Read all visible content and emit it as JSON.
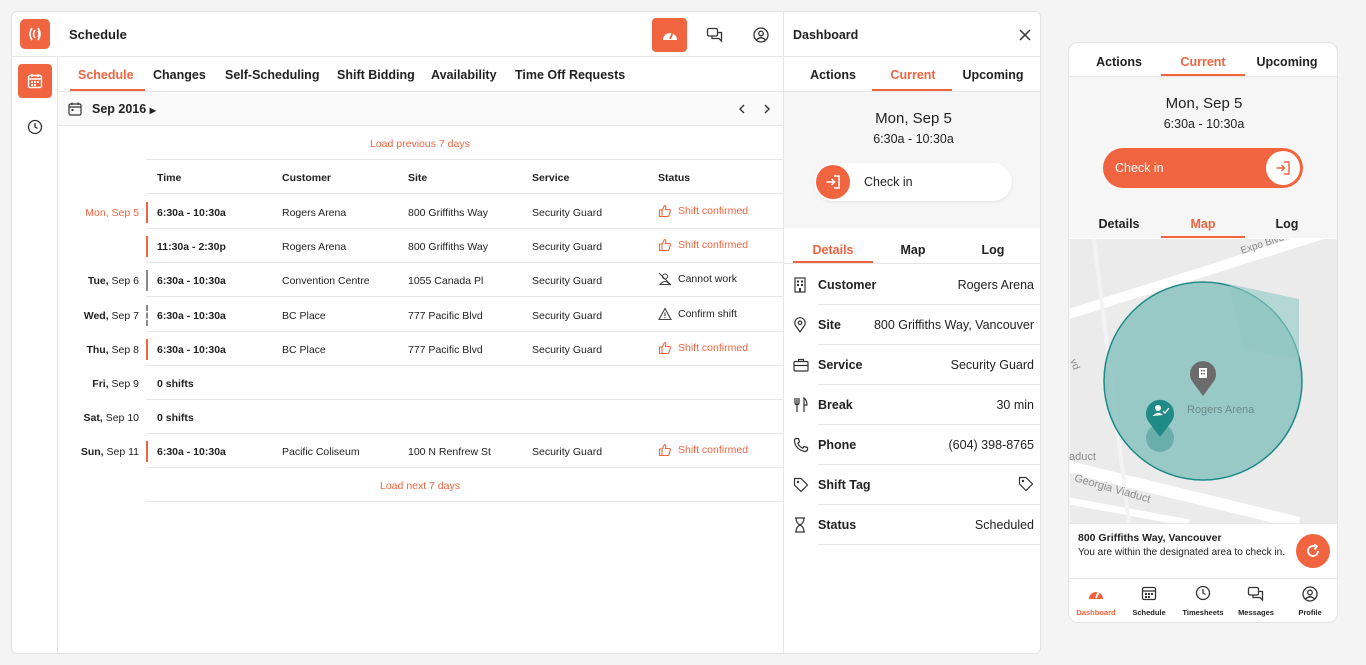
{
  "app": {
    "title": "Schedule"
  },
  "tabs": [
    "Schedule",
    "Changes",
    "Self-Scheduling",
    "Shift Bidding",
    "Availability",
    "Time Off Requests"
  ],
  "month": {
    "label": "Sep 2016"
  },
  "load_previous": "Load previous 7 days",
  "load_next": "Load next 7 days",
  "table": {
    "headers": [
      "Time",
      "Customer",
      "Site",
      "Service",
      "Status"
    ],
    "rows": [
      {
        "day_name": "Mon,",
        "day_num": "Sep 5",
        "time": "6:30a - 10:30a",
        "customer": "Rogers Arena",
        "site": "800 Griffiths Way",
        "service": "Security Guard",
        "status": "Shift confirmed"
      },
      {
        "day_name": "",
        "day_num": "",
        "time": "11:30a - 2:30p",
        "customer": "Rogers Arena",
        "site": "800 Griffiths Way",
        "service": "Security Guard",
        "status": "Shift confirmed"
      },
      {
        "day_name": "Tue,",
        "day_num": "Sep 6",
        "time": "6:30a - 10:30a",
        "customer": "Convention Centre",
        "site": "1055 Canada Pl",
        "service": "Security Guard",
        "status": "Cannot work"
      },
      {
        "day_name": "Wed,",
        "day_num": "Sep 7",
        "time": "6:30a - 10:30a",
        "customer": "BC Place",
        "site": "777 Pacific Blvd",
        "service": "Security Guard",
        "status": "Confirm shift"
      },
      {
        "day_name": "Thu,",
        "day_num": "Sep 8",
        "time": "6:30a - 10:30a",
        "customer": "BC Place",
        "site": "777 Pacific Blvd",
        "service": "Security Guard",
        "status": "Shift confirmed"
      },
      {
        "day_name": "Fri,",
        "day_num": "Sep 9",
        "time": "0 shifts",
        "customer": "",
        "site": "",
        "service": "",
        "status": ""
      },
      {
        "day_name": "Sat,",
        "day_num": "Sep 10",
        "time": "0 shifts",
        "customer": "",
        "site": "",
        "service": "",
        "status": ""
      },
      {
        "day_name": "Sun,",
        "day_num": "Sep 11",
        "time": "6:30a - 10:30a",
        "customer": "Pacific Coliseum",
        "site": "100 N Renfrew St",
        "service": "Security Guard",
        "status": "Shift confirmed"
      }
    ]
  },
  "dashboard": {
    "title": "Dashboard",
    "tabs": [
      "Actions",
      "Current",
      "Upcoming"
    ],
    "date": "Mon, Sep 5",
    "time": "6:30a - 10:30a",
    "checkin": "Check in",
    "detail_tabs": [
      "Details",
      "Map",
      "Log"
    ],
    "details": [
      {
        "label": "Customer",
        "value": "Rogers Arena"
      },
      {
        "label": "Site",
        "value": "800 Griffiths Way, Vancouver"
      },
      {
        "label": "Service",
        "value": "Security Guard"
      },
      {
        "label": "Break",
        "value": "30 min"
      },
      {
        "label": "Phone",
        "value": "(604) 398-8765"
      },
      {
        "label": "Shift Tag",
        "value": ""
      },
      {
        "label": "Status",
        "value": "Scheduled"
      }
    ]
  },
  "mobile": {
    "tabs": [
      "Actions",
      "Current",
      "Upcoming"
    ],
    "date": "Mon, Sep 5",
    "time": "6:30a - 10:30a",
    "checkin": "Check in",
    "detail_tabs": [
      "Details",
      "Map",
      "Log"
    ],
    "map": {
      "venue": "Rogers Arena",
      "streets": [
        "Expo Blvd",
        "Georgia Viaduct",
        "aduct",
        "vd"
      ]
    },
    "info_title": "800 Griffiths Way, Vancouver",
    "info_desc": "You are within the designated area to check in.",
    "nav": [
      "Dashboard",
      "Schedule",
      "Timesheets",
      "Messages",
      "Profile"
    ]
  },
  "colors": {
    "accent": "#f0643f",
    "teal": "#1f8a86",
    "grey": "#8a8a8a"
  }
}
